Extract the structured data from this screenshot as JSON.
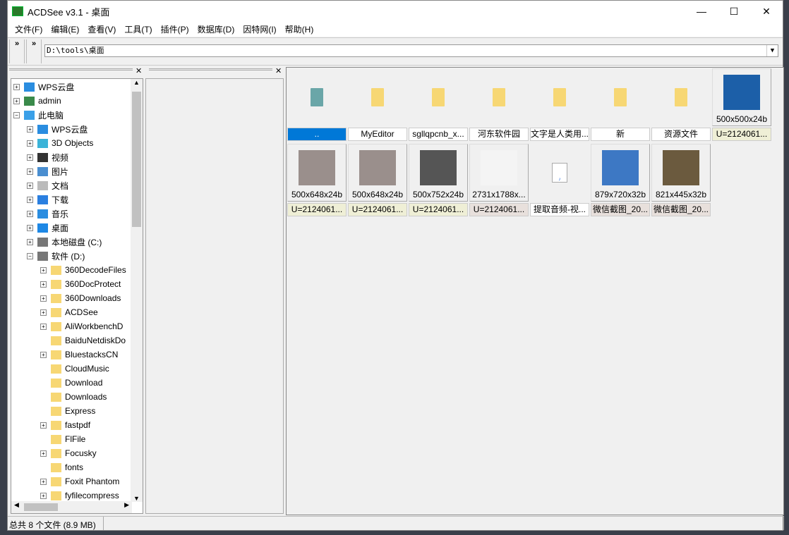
{
  "window": {
    "title": "ACDSee v3.1 - 桌面",
    "min": "—",
    "max": "☐",
    "close": "✕"
  },
  "menu": [
    "文件(F)",
    "编辑(E)",
    "查看(V)",
    "工具(T)",
    "插件(P)",
    "数据库(D)",
    "因特网(I)",
    "帮助(H)"
  ],
  "toolbar": {
    "grip1": "»",
    "grip2": "»",
    "address": "D:\\tools\\桌面",
    "dropdown": "▼"
  },
  "tree": [
    {
      "label": "WPS云盘",
      "level": 0,
      "exp": "+",
      "icon": "cloud-icon"
    },
    {
      "label": "admin",
      "level": 0,
      "exp": "+",
      "icon": "user-icon"
    },
    {
      "label": "此电脑",
      "level": 0,
      "exp": "−",
      "icon": "computer-icon"
    },
    {
      "label": "WPS云盘",
      "level": 1,
      "exp": "+",
      "icon": "cloud-icon"
    },
    {
      "label": "3D Objects",
      "level": 1,
      "exp": "+",
      "icon": "cube-icon"
    },
    {
      "label": "视频",
      "level": 1,
      "exp": "+",
      "icon": "video-icon"
    },
    {
      "label": "图片",
      "level": 1,
      "exp": "+",
      "icon": "picture-icon"
    },
    {
      "label": "文档",
      "level": 1,
      "exp": "+",
      "icon": "document-icon"
    },
    {
      "label": "下载",
      "level": 1,
      "exp": "+",
      "icon": "download-icon"
    },
    {
      "label": "音乐",
      "level": 1,
      "exp": "+",
      "icon": "music-icon"
    },
    {
      "label": "桌面",
      "level": 1,
      "exp": "+",
      "icon": "desktop-icon"
    },
    {
      "label": "本地磁盘 (C:)",
      "level": 1,
      "exp": "+",
      "icon": "drive-icon"
    },
    {
      "label": "软件 (D:)",
      "level": 1,
      "exp": "−",
      "icon": "drive-icon"
    },
    {
      "label": "360DecodeFiles",
      "level": 2,
      "exp": "+",
      "icon": "folder-icon"
    },
    {
      "label": "360DocProtect",
      "level": 2,
      "exp": "+",
      "icon": "folder-icon"
    },
    {
      "label": "360Downloads",
      "level": 2,
      "exp": "+",
      "icon": "folder-icon"
    },
    {
      "label": "ACDSee",
      "level": 2,
      "exp": "+",
      "icon": "folder-icon"
    },
    {
      "label": "AliWorkbenchD",
      "level": 2,
      "exp": "+",
      "icon": "folder-icon"
    },
    {
      "label": "BaiduNetdiskDo",
      "level": 2,
      "exp": "",
      "icon": "folder-icon"
    },
    {
      "label": "BluestacksCN",
      "level": 2,
      "exp": "+",
      "icon": "folder-icon"
    },
    {
      "label": "CloudMusic",
      "level": 2,
      "exp": "",
      "icon": "folder-icon"
    },
    {
      "label": "Download",
      "level": 2,
      "exp": "",
      "icon": "folder-icon"
    },
    {
      "label": "Downloads",
      "level": 2,
      "exp": "",
      "icon": "folder-icon"
    },
    {
      "label": "Express",
      "level": 2,
      "exp": "",
      "icon": "folder-icon"
    },
    {
      "label": "fastpdf",
      "level": 2,
      "exp": "+",
      "icon": "folder-icon"
    },
    {
      "label": "FlFile",
      "level": 2,
      "exp": "",
      "icon": "folder-icon"
    },
    {
      "label": "Focusky",
      "level": 2,
      "exp": "+",
      "icon": "folder-icon"
    },
    {
      "label": "fonts",
      "level": 2,
      "exp": "",
      "icon": "folder-icon"
    },
    {
      "label": "Foxit Phantom",
      "level": 2,
      "exp": "+",
      "icon": "folder-icon"
    },
    {
      "label": "fyfilecompress",
      "level": 2,
      "exp": "+",
      "icon": "folder-icon"
    }
  ],
  "thumbnails": [
    {
      "type": "parent",
      "label": "..",
      "info": "",
      "selected": true
    },
    {
      "type": "folder",
      "label": "MyEditor",
      "info": ""
    },
    {
      "type": "folder",
      "label": "sgllqpcnb_x...",
      "info": ""
    },
    {
      "type": "folder",
      "label": "河东软件园",
      "info": ""
    },
    {
      "type": "folder",
      "label": "文字是人类用...",
      "info": ""
    },
    {
      "type": "folder",
      "label": "新",
      "info": ""
    },
    {
      "type": "folder",
      "label": "资源文件",
      "info": ""
    },
    {
      "type": "image",
      "label": "U=2124061...",
      "info": "500x500x24b",
      "color": "#1c5fa8"
    },
    {
      "type": "image",
      "label": "U=2124061...",
      "info": "500x648x24b",
      "color": "#9a8f8c"
    },
    {
      "type": "image",
      "label": "U=2124061...",
      "info": "500x648x24b",
      "color": "#9a8f8c"
    },
    {
      "type": "image",
      "label": "U=2124061...",
      "info": "500x752x24b",
      "color": "#555555"
    },
    {
      "type": "image",
      "label": "U=2124061...",
      "info": "2731x1788x...",
      "color": "#f4f4f4"
    },
    {
      "type": "mp3",
      "label": "提取音频-视...",
      "info": ""
    },
    {
      "type": "image",
      "label": "微信截图_20...",
      "info": "879x720x32b",
      "color": "#3d78c4"
    },
    {
      "type": "image",
      "label": "微信截图_20...",
      "info": "821x445x32b",
      "color": "#6b5a3e"
    }
  ],
  "status": {
    "summary": "总共 8 个文件 (8.9 MB)"
  }
}
